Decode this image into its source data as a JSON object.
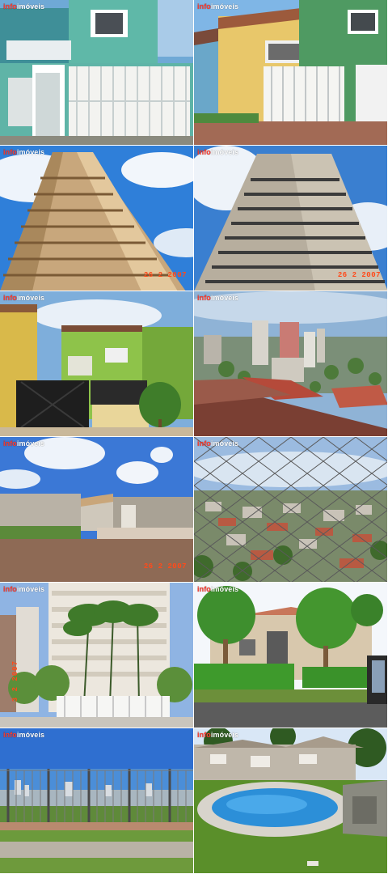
{
  "watermark": {
    "part_a": "info",
    "part_b": "imóveis"
  },
  "stamps": {
    "tile3": "26 2 2007",
    "tile4": "26 2 2007",
    "tile9": "26 2 2007",
    "tile11": "3 2 2007"
  }
}
